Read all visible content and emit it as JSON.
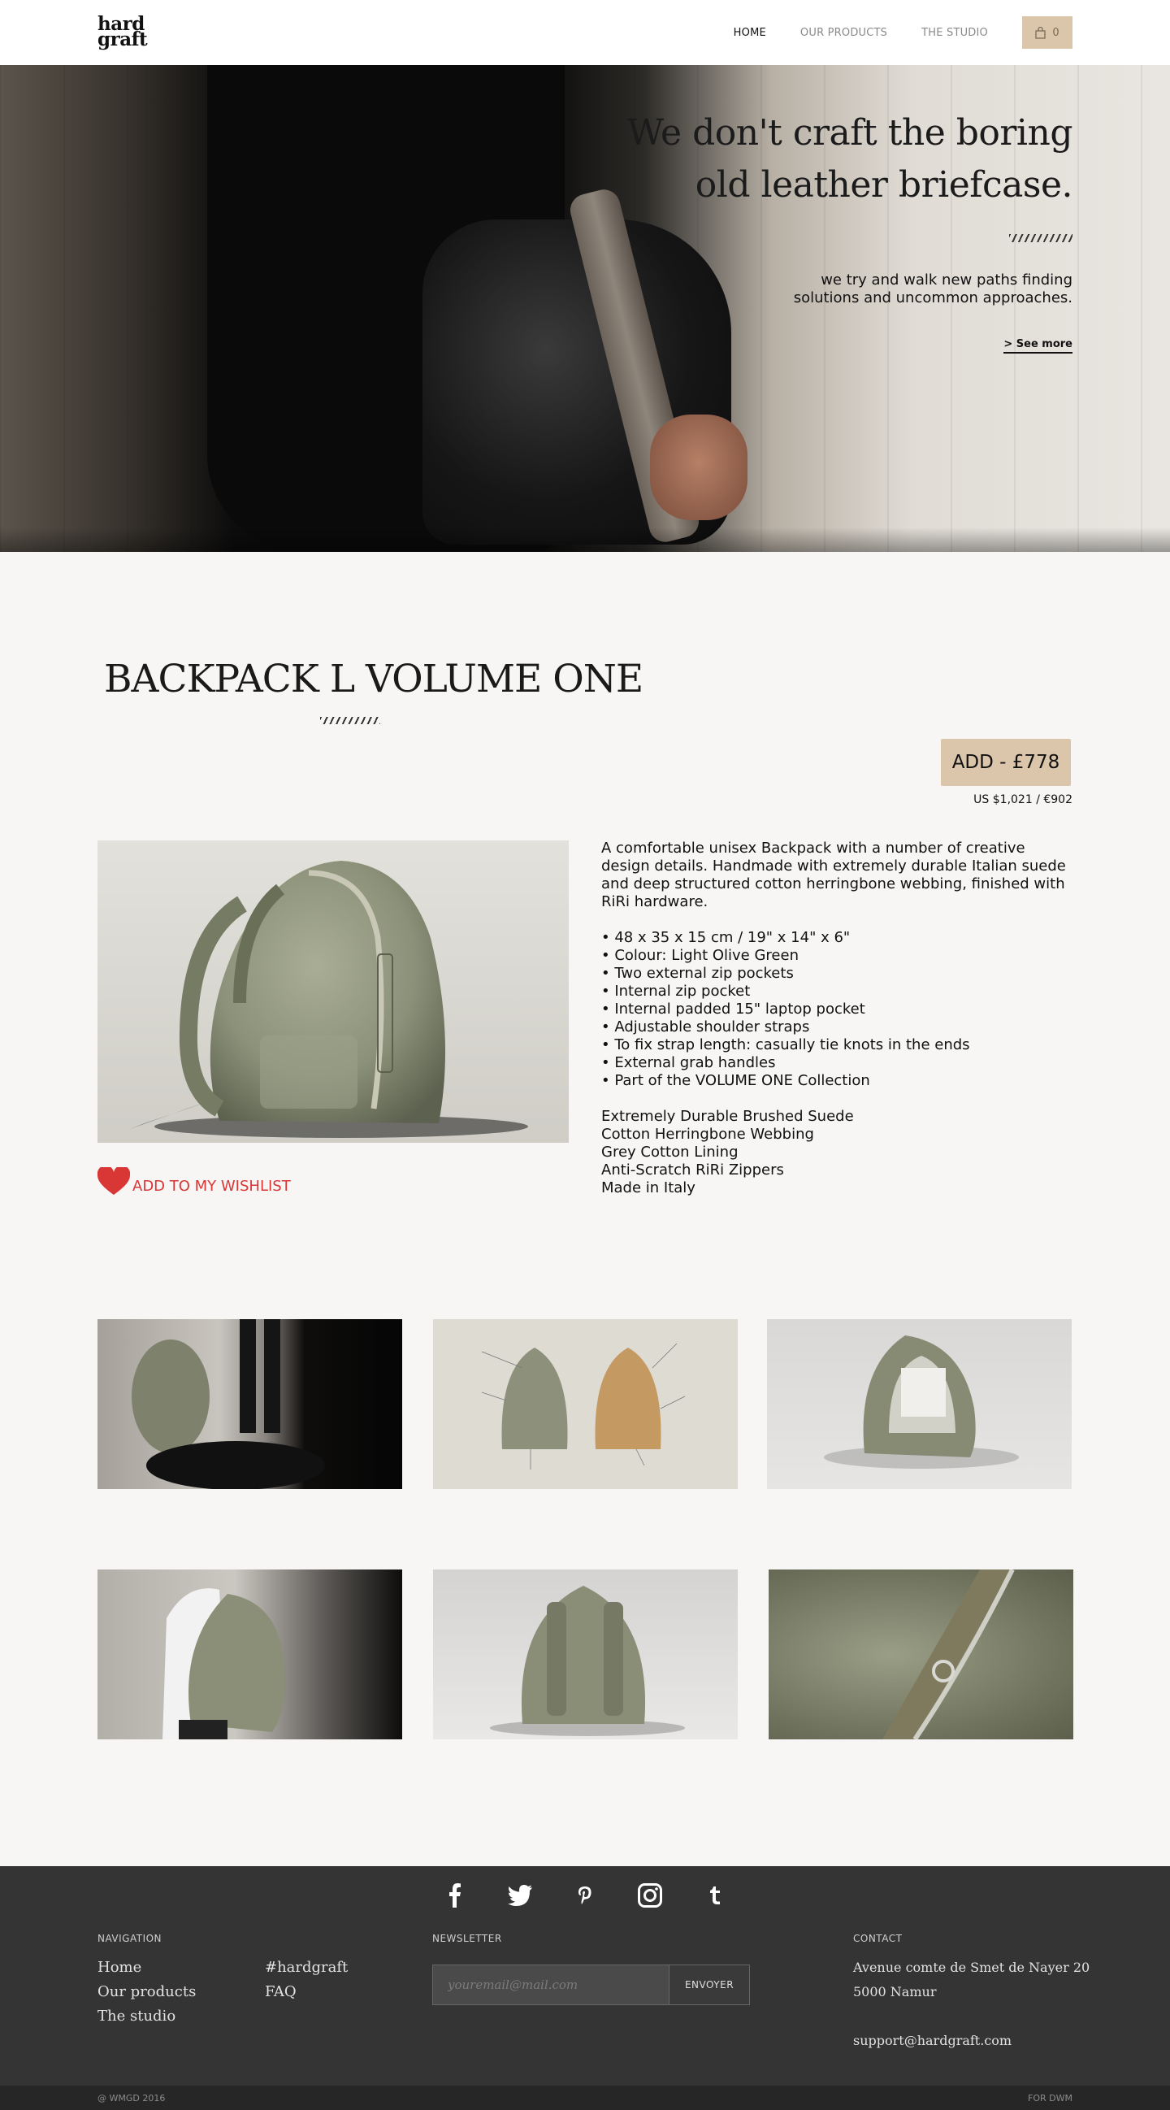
{
  "header": {
    "logo_line1": "hard",
    "logo_line2": "graft",
    "nav": [
      "HOME",
      "OUR PRODUCTS",
      "THE STUDIO"
    ],
    "cart_count": "0"
  },
  "hero": {
    "title_line1": "We don't craft the boring",
    "title_line2": "old leather briefcase.",
    "subtitle_line1": "we try and walk new paths finding",
    "subtitle_line2": "solutions and uncommon approaches.",
    "link": "> See more"
  },
  "product": {
    "title": "BACKPACK L VOLUME ONE",
    "add_button": "ADD - £778",
    "price_alt": "US $1,021 / €902",
    "wishlist": "ADD TO MY WISHLIST",
    "description": "A comfortable unisex Backpack with a number of creative design details. Handmade with extremely durable Italian suede and deep structured cotton herringbone webbing, finished with RiRi hardware.",
    "features": [
      "• 48 x 35 x 15 cm / 19\" x 14\" x 6\"",
      "• Colour: Light Olive Green",
      "• Two external zip pockets",
      "• Internal zip pocket",
      "• Internal padded 15\" laptop pocket",
      "• Adjustable shoulder straps",
      "• To fix strap length: casually tie knots in the ends",
      "• External grab handles",
      "• Part of the VOLUME ONE Collection"
    ],
    "materials": [
      "Extremely Durable Brushed Suede",
      "Cotton Herringbone Webbing",
      "Grey Cotton Lining",
      "Anti-Scratch RiRi Zippers",
      "Made in Italy"
    ]
  },
  "footer": {
    "socials": [
      "facebook-icon",
      "twitter-icon",
      "pinterest-icon",
      "instagram-icon",
      "tumblr-icon"
    ],
    "nav_title": "NAVIGATION",
    "nav_col1": [
      "Home",
      "Our products",
      "The studio"
    ],
    "nav_col2": [
      "#hardgraft",
      "FAQ"
    ],
    "newsletter_title": "NEWSLETTER",
    "newsletter_placeholder": "youremail@mail.com",
    "newsletter_button": "ENVOYER",
    "contact_title": "CONTACT",
    "address_line1": "Avenue comte de Smet de Nayer 20",
    "address_line2": "5000 Namur",
    "email": "support@hardgraft.com",
    "copyright": "@ WMGD 2016",
    "credit": "FOR DWM"
  },
  "colors": {
    "accent": "#dbc6ab",
    "wishlist": "#d93636",
    "footer_bg": "#343434",
    "page_bg": "#f7f6f4"
  }
}
